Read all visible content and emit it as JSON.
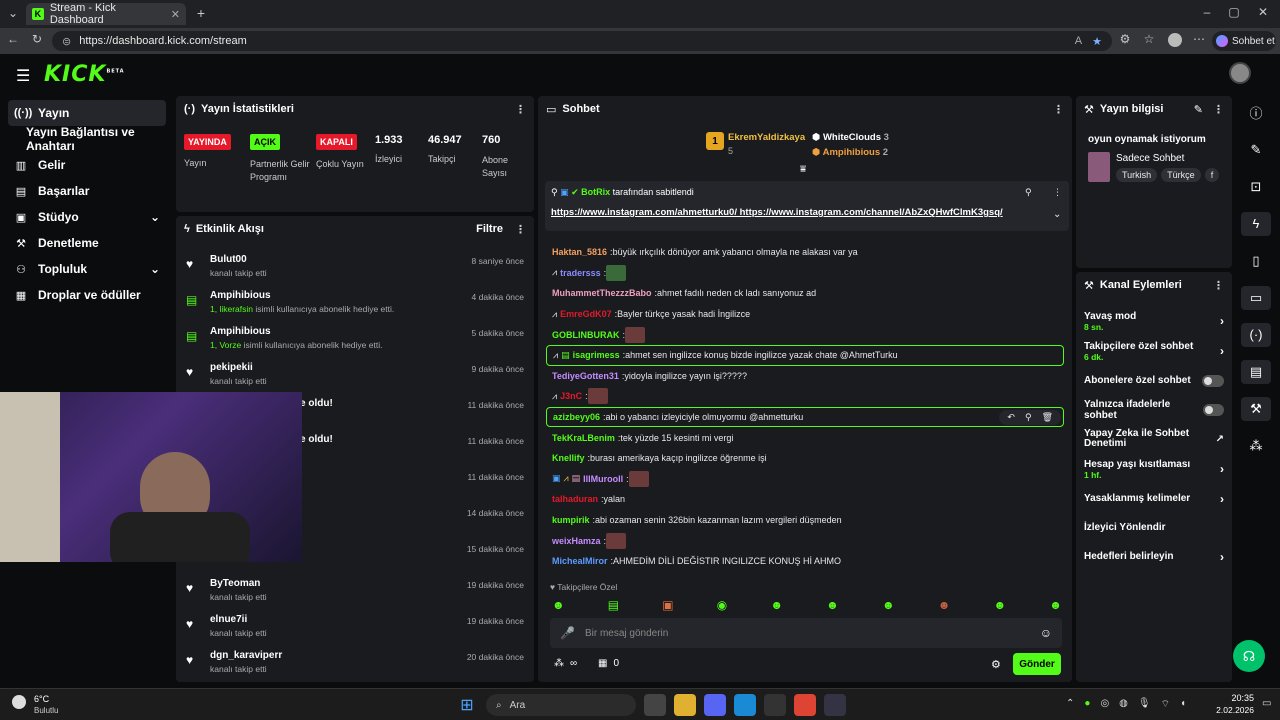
{
  "browser": {
    "tab_title": "Stream - Kick Dashboard",
    "url": "https://dashboard.kick.com/stream",
    "sync_label": "Sohbet et"
  },
  "header": {
    "logo_text": "KICK",
    "logo_tag": "BETA"
  },
  "sidebar": {
    "items": [
      {
        "label": "Yayın",
        "icon": "broadcast-icon"
      },
      {
        "label": "Yayın Bağlantısı ve Anahtarı",
        "icon": ""
      },
      {
        "label": "Gelir",
        "icon": "chart-icon"
      },
      {
        "label": "Başarılar",
        "icon": "trophy-icon"
      },
      {
        "label": "Stüdyo",
        "icon": "studio-icon"
      },
      {
        "label": "Denetleme",
        "icon": "hammer-icon"
      },
      {
        "label": "Topluluk",
        "icon": "users-icon"
      },
      {
        "label": "Droplar ve ödüller",
        "icon": "gift-icon"
      }
    ]
  },
  "stats": {
    "title": "Yayın İstatistikleri",
    "badges": [
      {
        "badge": "YAYINDA",
        "label": "Yayın",
        "color": "#e5192a"
      },
      {
        "badge": "AÇIK",
        "label": "Partnerlik Gelir Programı",
        "color": "#53fc18"
      },
      {
        "badge": "KAPALI",
        "label": "Çoklu Yayın",
        "color": "#e5192a"
      }
    ],
    "numbers": [
      {
        "value": "1.933",
        "label": "İzleyici"
      },
      {
        "value": "46.947",
        "label": "Takipçi"
      },
      {
        "value": "760",
        "label": "Abone Sayısı"
      }
    ]
  },
  "feed": {
    "title": "Etkinlik Akışı",
    "filter": "Filtre",
    "items": [
      {
        "icon": "heart-icon",
        "name": "Bulut00",
        "sub": "kanalı takip etti",
        "time": "8 saniye önce"
      },
      {
        "icon": "gift-icon",
        "name": "Ampihibious",
        "sub_hl": "1, likerafsin",
        "sub": " isimli kullanıcıya abonelik hediye etti.",
        "time": "4 dakika önce"
      },
      {
        "icon": "gift-icon",
        "name": "Ampihibious",
        "sub_hl": "1, Vorze",
        "sub": " isimli kullanıcıya abonelik hediye etti.",
        "time": "5 dakika önce"
      },
      {
        "icon": "heart-icon",
        "name": "pekipekii",
        "sub": "kanalı takip etti",
        "time": "9 dakika önce"
      },
      {
        "icon": "",
        "name": "e oldu!",
        "sub": "",
        "time": "11 dakika önce"
      },
      {
        "icon": "",
        "name": "e oldu!",
        "sub": "",
        "time": "11 dakika önce"
      },
      {
        "icon": "",
        "name": "",
        "sub": "",
        "time": "11 dakika önce"
      },
      {
        "icon": "",
        "name": "",
        "sub": "",
        "time": "14 dakika önce"
      },
      {
        "icon": "",
        "name": "",
        "sub": "",
        "time": "15 dakika önce"
      },
      {
        "icon": "heart-icon",
        "name": "ByTeoman",
        "sub": "kanalı takip etti",
        "time": "19 dakika önce"
      },
      {
        "icon": "heart-icon",
        "name": "elnue7ii",
        "sub": "kanalı takip etti",
        "time": "19 dakika önce"
      },
      {
        "icon": "heart-icon",
        "name": "dgn_karaviperr",
        "sub": "kanalı takip etti",
        "time": "20 dakika önce"
      }
    ]
  },
  "chat": {
    "title": "Sohbet",
    "top_gifters": [
      {
        "name": "EkremYaldizkaya",
        "count": "5",
        "rank": "1"
      },
      {
        "name": "WhiteClouds",
        "count": "3"
      },
      {
        "name": "Ampihibious",
        "count": "2"
      }
    ],
    "pinned": {
      "by": "BotRix",
      "by_suffix": "tarafından sabitlendi",
      "text": "https://www.instagram.com/ahmetturku0/ https://www.instagram.com/channel/AbZxQHwfClmK3gsq/"
    },
    "messages": [
      {
        "user": "Haktan_5816",
        "color": "#f5a060",
        "text": "büyük ırkçılık dönüyor amk yabancı olmayla ne alakası var ya"
      },
      {
        "user": "tradersss",
        "color": "#8b8bff",
        "text": "",
        "emote": true
      },
      {
        "user": "MuhammetThezzzBabo",
        "color": "#f0a0c0",
        "text": "ahmet fadılı neden ck ladı sanıyonuz ad"
      },
      {
        "user": "EmreGdK07",
        "color": "#e5192a",
        "text": "Bayler türkçe yasak hadi İngilizce"
      },
      {
        "user": "GOBLINBURAK",
        "color": "#53fc18",
        "text": "",
        "emote": true
      },
      {
        "user": "isagrimess",
        "color": "#53fc18",
        "text": "ahmet sen ingilizce konuş bizde ingilizce yazak chate @AhmetTurku",
        "highlight": true
      },
      {
        "user": "TediyeGotten31",
        "color": "#c58cff",
        "text": "yidoyla ingilizce yayın işi?????"
      },
      {
        "user": "J3nC",
        "color": "#e5192a",
        "text": "",
        "emote": true
      },
      {
        "user": "azizbeyy06",
        "color": "#53fc18",
        "text": "abi o yabancı izleyiciyle olmuyormu @ahmetturku",
        "highlight": true
      },
      {
        "user": "TekKraLBenim",
        "color": "#53fc18",
        "text": "tek yüzde 15 kesinti mi vergi"
      },
      {
        "user": "Knellify",
        "color": "#53fc18",
        "text": "burası amerikaya kaçıp ingilizce öğrenme işi"
      },
      {
        "user": "IllMurooll",
        "color": "#c58cff",
        "text": "",
        "emote": true
      },
      {
        "user": "talhaduran",
        "color": "#e5192a",
        "text": "yalan"
      },
      {
        "user": "kumpirik",
        "color": "#53fc18",
        "text": "abi ozaman senin 326bin kazanman lazım vergileri düşmeden"
      },
      {
        "user": "weixHamza",
        "color": "#c58cff",
        "text": "",
        "emote": true
      },
      {
        "user": "MicheaIMiror",
        "color": "#5b9cff",
        "text": "AHMEDİM DİLİ DEĞİSTIR INGILIZCE KONUŞ Hİ AHMO"
      }
    ],
    "followers_only": "Takipçilere Özel",
    "input_placeholder": "Bir mesaj gönderin",
    "points": "∞",
    "gift_count": "0",
    "send_label": "Gönder"
  },
  "stream_info": {
    "title": "Yayın bilgisi",
    "stream_title": "oyun oynamak istiyorum",
    "category": "Sadece Sohbet",
    "tags": [
      "Turkish",
      "Türkçe",
      "f"
    ]
  },
  "channel_actions": {
    "title": "Kanal Eylemleri",
    "items": [
      {
        "label": "Yavaş mod",
        "value": "8 sn.",
        "control": "chevron"
      },
      {
        "label": "Takipçilere özel sohbet",
        "value": "6 dk.",
        "control": "chevron"
      },
      {
        "label": "Abonelere özel sohbet",
        "value": "",
        "control": "toggle"
      },
      {
        "label": "Yalnızca ifadelerle sohbet",
        "value": "",
        "control": "toggle"
      },
      {
        "label": "Yapay Zeka ile Sohbet Denetimi",
        "value": "",
        "control": "external"
      },
      {
        "label": "Hesap yaşı kısıtlaması",
        "value": "1 hf.",
        "control": "chevron"
      },
      {
        "label": "Yasaklanmış kelimeler",
        "value": "",
        "control": "chevron"
      },
      {
        "label": "İzleyici Yönlendir",
        "value": "",
        "control": "none"
      },
      {
        "label": "Hedefleri belirleyin",
        "value": "",
        "control": "chevron"
      }
    ]
  },
  "taskbar": {
    "weather_temp": "6°C",
    "weather_desc": "Bulutlu",
    "search": "Ara",
    "time": "20:35",
    "date": "2.02.2026"
  },
  "colors": {
    "accent": "#53fc18",
    "live": "#e5192a",
    "panel": "#191b1f"
  }
}
